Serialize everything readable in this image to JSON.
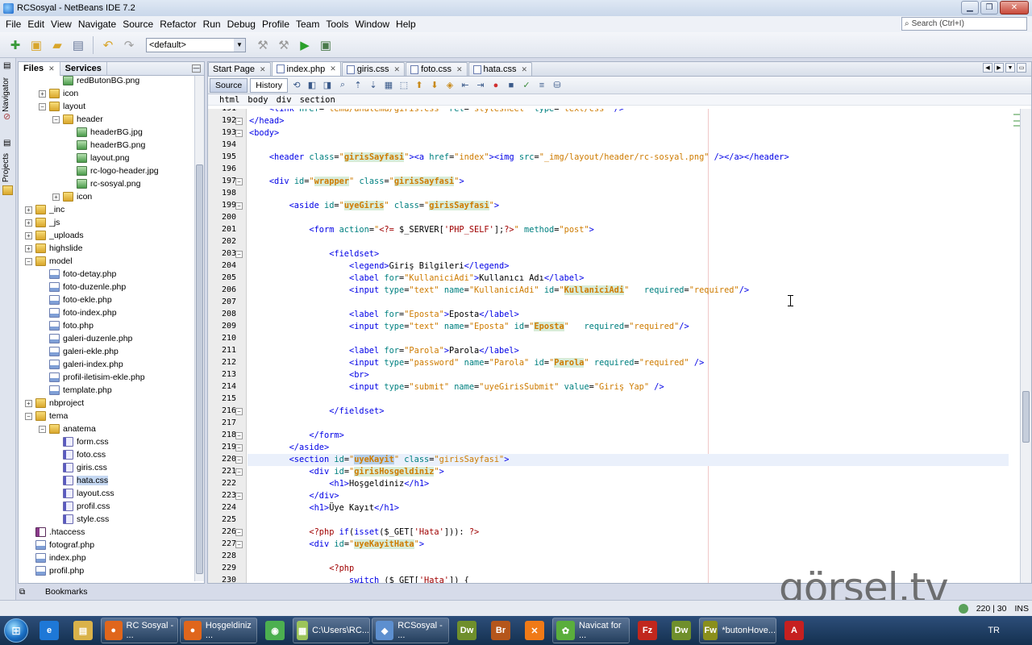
{
  "window": {
    "title": "RCSosyal - NetBeans IDE 7.2"
  },
  "menu": [
    "File",
    "Edit",
    "View",
    "Navigate",
    "Source",
    "Refactor",
    "Run",
    "Debug",
    "Profile",
    "Team",
    "Tools",
    "Window",
    "Help"
  ],
  "search": {
    "placeholder": "Search (Ctrl+I)"
  },
  "toolbar": {
    "config_value": "<default>"
  },
  "side_tabs": {
    "navigator": "Navigator",
    "projects": "Projects"
  },
  "files_panel": {
    "tabs": [
      "Files",
      "Services"
    ],
    "tree": [
      {
        "label": "redButonBG.png",
        "depth": 3,
        "type": "img",
        "exp": ""
      },
      {
        "label": "icon",
        "depth": 2,
        "type": "folder",
        "exp": "+"
      },
      {
        "label": "layout",
        "depth": 2,
        "type": "folder",
        "exp": "-"
      },
      {
        "label": "header",
        "depth": 3,
        "type": "folder",
        "exp": "-"
      },
      {
        "label": "headerBG.jpg",
        "depth": 4,
        "type": "img",
        "exp": ""
      },
      {
        "label": "headerBG.png",
        "depth": 4,
        "type": "img",
        "exp": ""
      },
      {
        "label": "layout.png",
        "depth": 4,
        "type": "img",
        "exp": ""
      },
      {
        "label": "rc-logo-header.jpg",
        "depth": 4,
        "type": "img",
        "exp": ""
      },
      {
        "label": "rc-sosyal.png",
        "depth": 4,
        "type": "img",
        "exp": ""
      },
      {
        "label": "icon",
        "depth": 3,
        "type": "folder",
        "exp": "+"
      },
      {
        "label": "_inc",
        "depth": 1,
        "type": "folder",
        "exp": "+"
      },
      {
        "label": "_js",
        "depth": 1,
        "type": "folder",
        "exp": "+"
      },
      {
        "label": "_uploads",
        "depth": 1,
        "type": "folder",
        "exp": "+"
      },
      {
        "label": "highslide",
        "depth": 1,
        "type": "folder",
        "exp": "+"
      },
      {
        "label": "model",
        "depth": 1,
        "type": "folder",
        "exp": "-"
      },
      {
        "label": "foto-detay.php",
        "depth": 2,
        "type": "php",
        "exp": ""
      },
      {
        "label": "foto-duzenle.php",
        "depth": 2,
        "type": "php",
        "exp": ""
      },
      {
        "label": "foto-ekle.php",
        "depth": 2,
        "type": "php",
        "exp": ""
      },
      {
        "label": "foto-index.php",
        "depth": 2,
        "type": "php",
        "exp": ""
      },
      {
        "label": "foto.php",
        "depth": 2,
        "type": "php",
        "exp": ""
      },
      {
        "label": "galeri-duzenle.php",
        "depth": 2,
        "type": "php",
        "exp": ""
      },
      {
        "label": "galeri-ekle.php",
        "depth": 2,
        "type": "php",
        "exp": ""
      },
      {
        "label": "galeri-index.php",
        "depth": 2,
        "type": "php",
        "exp": ""
      },
      {
        "label": "profil-iletisim-ekle.php",
        "depth": 2,
        "type": "php",
        "exp": ""
      },
      {
        "label": "template.php",
        "depth": 2,
        "type": "php",
        "exp": ""
      },
      {
        "label": "nbproject",
        "depth": 1,
        "type": "folder",
        "exp": "+"
      },
      {
        "label": "tema",
        "depth": 1,
        "type": "folder",
        "exp": "-"
      },
      {
        "label": "anatema",
        "depth": 2,
        "type": "folder",
        "exp": "-"
      },
      {
        "label": "form.css",
        "depth": 3,
        "type": "css",
        "exp": ""
      },
      {
        "label": "foto.css",
        "depth": 3,
        "type": "css",
        "exp": ""
      },
      {
        "label": "giris.css",
        "depth": 3,
        "type": "css",
        "exp": ""
      },
      {
        "label": "hata.css",
        "depth": 3,
        "type": "css",
        "exp": "",
        "selected": true
      },
      {
        "label": "layout.css",
        "depth": 3,
        "type": "css",
        "exp": ""
      },
      {
        "label": "profil.css",
        "depth": 3,
        "type": "css",
        "exp": ""
      },
      {
        "label": "style.css",
        "depth": 3,
        "type": "css",
        "exp": ""
      },
      {
        "label": ".htaccess",
        "depth": 1,
        "type": "hta",
        "exp": ""
      },
      {
        "label": "fotograf.php",
        "depth": 1,
        "type": "php",
        "exp": ""
      },
      {
        "label": "index.php",
        "depth": 1,
        "type": "php",
        "exp": ""
      },
      {
        "label": "profil.php",
        "depth": 1,
        "type": "php",
        "exp": ""
      }
    ],
    "bookmarks": "Bookmarks"
  },
  "editor": {
    "tabs": [
      {
        "label": "Start Page",
        "active": false
      },
      {
        "label": "index.php",
        "active": true
      },
      {
        "label": "giris.css",
        "active": false
      },
      {
        "label": "foto.css",
        "active": false
      },
      {
        "label": "hata.css",
        "active": false
      }
    ],
    "source_label": "Source",
    "history_label": "History",
    "breadcrumb": [
      "html",
      "body",
      "div",
      "section"
    ],
    "current_line": 220,
    "lines": [
      {
        "n": 191,
        "fold": "",
        "html": "    <span class=\"t\">&lt;link</span> <span class=\"a\">href</span>=<span class=\"v\">\"tema/anatema/giris.css\"</span> <span class=\"a\">rel</span>=<span class=\"v\">\"stylesheet\"</span> <span class=\"a\">type</span>=<span class=\"v\">\"text/css\"</span> <span class=\"t\">/&gt;</span>"
      },
      {
        "n": 192,
        "fold": "-",
        "html": "<span class=\"t\">&lt;/head&gt;</span>"
      },
      {
        "n": 193,
        "fold": "-",
        "html": "<span class=\"t\">&lt;body&gt;</span>"
      },
      {
        "n": 194,
        "fold": "",
        "html": ""
      },
      {
        "n": 195,
        "fold": "",
        "html": "    <span class=\"t\">&lt;header</span> <span class=\"a\">class</span>=<span class=\"v\">\"<span class=\"hl\">girisSayfasi</span>\"</span><span class=\"t\">&gt;&lt;a</span> <span class=\"a\">href</span>=<span class=\"v\">\"index\"</span><span class=\"t\">&gt;&lt;img</span> <span class=\"a\">src</span>=<span class=\"v\">\"_img/layout/header/rc-sosyal.png\"</span> <span class=\"t\">/&gt;&lt;/a&gt;&lt;/header&gt;</span>"
      },
      {
        "n": 196,
        "fold": "",
        "html": ""
      },
      {
        "n": 197,
        "fold": "-",
        "html": "    <span class=\"t\">&lt;div</span> <span class=\"a\">id</span>=<span class=\"v\">\"<span class=\"hl\">wrapper</span>\"</span> <span class=\"a\">class</span>=<span class=\"v\">\"<span class=\"hl\">girisSayfasi</span>\"</span><span class=\"t\">&gt;</span>"
      },
      {
        "n": 198,
        "fold": "",
        "html": ""
      },
      {
        "n": 199,
        "fold": "-",
        "html": "        <span class=\"t\">&lt;aside</span> <span class=\"a\">id</span>=<span class=\"v\">\"<span class=\"hl\">uyeGiris</span>\"</span> <span class=\"a\">class</span>=<span class=\"v\">\"<span class=\"hl\">girisSayfasi</span>\"</span><span class=\"t\">&gt;</span>"
      },
      {
        "n": 200,
        "fold": "",
        "html": ""
      },
      {
        "n": 201,
        "fold": "",
        "html": "            <span class=\"t\">&lt;form</span> <span class=\"a\">action</span>=<span class=\"v\">\"</span><span class=\"phpk\">&lt;?=</span> $_SERVER[<span class=\"phpk\">'PHP_SELF'</span>];<span class=\"phpk\">?&gt;</span><span class=\"v\">\"</span> <span class=\"a\">method</span>=<span class=\"v\">\"post\"</span><span class=\"t\">&gt;</span>"
      },
      {
        "n": 202,
        "fold": "",
        "html": ""
      },
      {
        "n": 203,
        "fold": "-",
        "html": "                <span class=\"t\">&lt;fieldset&gt;</span>"
      },
      {
        "n": 204,
        "fold": "",
        "html": "                    <span class=\"t\">&lt;legend&gt;</span>Giriş Bilgileri<span class=\"t\">&lt;/legend&gt;</span>"
      },
      {
        "n": 205,
        "fold": "",
        "html": "                    <span class=\"t\">&lt;label</span> <span class=\"a\">for</span>=<span class=\"v\">\"KullaniciAdi\"</span><span class=\"t\">&gt;</span>Kullanıcı Adı<span class=\"t\">&lt;/label&gt;</span>"
      },
      {
        "n": 206,
        "fold": "",
        "html": "                    <span class=\"t\">&lt;input</span> <span class=\"a\">type</span>=<span class=\"v\">\"text\"</span> <span class=\"a\">name</span>=<span class=\"v\">\"KullaniciAdi\"</span> <span class=\"a\">id</span>=<span class=\"v\">\"<span class=\"hl\">KullaniciAdi</span>\"</span>   <span class=\"a\">required</span>=<span class=\"v\">\"required\"</span><span class=\"t\">/&gt;</span>"
      },
      {
        "n": 207,
        "fold": "",
        "html": ""
      },
      {
        "n": 208,
        "fold": "",
        "html": "                    <span class=\"t\">&lt;label</span> <span class=\"a\">for</span>=<span class=\"v\">\"Eposta\"</span><span class=\"t\">&gt;</span>Eposta<span class=\"t\">&lt;/label&gt;</span>"
      },
      {
        "n": 209,
        "fold": "",
        "html": "                    <span class=\"t\">&lt;input</span> <span class=\"a\">type</span>=<span class=\"v\">\"text\"</span> <span class=\"a\">name</span>=<span class=\"v\">\"Eposta\"</span> <span class=\"a\">id</span>=<span class=\"v\">\"<span class=\"hl\">Eposta</span>\"</span>   <span class=\"a\">required</span>=<span class=\"v\">\"required\"</span><span class=\"t\">/&gt;</span>"
      },
      {
        "n": 210,
        "fold": "",
        "html": ""
      },
      {
        "n": 211,
        "fold": "",
        "html": "                    <span class=\"t\">&lt;label</span> <span class=\"a\">for</span>=<span class=\"v\">\"Parola\"</span><span class=\"t\">&gt;</span>Parola<span class=\"t\">&lt;/label&gt;</span>"
      },
      {
        "n": 212,
        "fold": "",
        "html": "                    <span class=\"t\">&lt;input</span> <span class=\"a\">type</span>=<span class=\"v\">\"password\"</span> <span class=\"a\">name</span>=<span class=\"v\">\"Parola\"</span> <span class=\"a\">id</span>=<span class=\"v\">\"<span class=\"hl\">Parola</span>\"</span> <span class=\"a\">required</span>=<span class=\"v\">\"required\"</span> <span class=\"t\">/&gt;</span>"
      },
      {
        "n": 213,
        "fold": "",
        "html": "                    <span class=\"t\">&lt;br&gt;</span>"
      },
      {
        "n": 214,
        "fold": "",
        "html": "                    <span class=\"t\">&lt;input</span> <span class=\"a\">type</span>=<span class=\"v\">\"submit\"</span> <span class=\"a\">name</span>=<span class=\"v\">\"uyeGirisSubmit\"</span> <span class=\"a\">value</span>=<span class=\"v\">\"Giriş Yap\"</span> <span class=\"t\">/&gt;</span>"
      },
      {
        "n": 215,
        "fold": "",
        "html": ""
      },
      {
        "n": 216,
        "fold": "-",
        "html": "                <span class=\"t\">&lt;/fieldset&gt;</span>"
      },
      {
        "n": 217,
        "fold": "",
        "html": ""
      },
      {
        "n": 218,
        "fold": "-",
        "html": "            <span class=\"t\">&lt;/form&gt;</span>"
      },
      {
        "n": 219,
        "fold": "-",
        "html": "        <span class=\"t\">&lt;/aside&gt;</span>"
      },
      {
        "n": 220,
        "fold": "-",
        "html": "        <span class=\"t\">&lt;section</span> <span class=\"a\">id</span>=<span class=\"v\">\"<span class=\"hl\" style=\"background:#b6cee8\">uyeKayit</span>\"</span> <span class=\"a\">class</span>=<span class=\"v\">\"girisSayfasi\"</span><span class=\"t\">&gt;</span>"
      },
      {
        "n": 221,
        "fold": "-",
        "html": "            <span class=\"t\">&lt;div</span> <span class=\"a\">id</span>=<span class=\"v\">\"<span class=\"hl\">girisHosgeldiniz</span>\"</span><span class=\"t\">&gt;</span>"
      },
      {
        "n": 222,
        "fold": "",
        "html": "                <span class=\"t\">&lt;h1&gt;</span>Hoşgeldiniz<span class=\"t\">&lt;/h1&gt;</span>"
      },
      {
        "n": 223,
        "fold": "-",
        "html": "            <span class=\"t\">&lt;/div&gt;</span>"
      },
      {
        "n": 224,
        "fold": "",
        "html": "            <span class=\"t\">&lt;h1&gt;</span>Üye Kayıt<span class=\"t\">&lt;/h1&gt;</span>"
      },
      {
        "n": 225,
        "fold": "",
        "html": ""
      },
      {
        "n": 226,
        "fold": "-",
        "html": "            <span class=\"phpk\">&lt;?php</span> <span class=\"t\">if</span>(<span class=\"t\">isset</span>($_GET[<span class=\"phpk\">'Hata'</span>])): <span class=\"phpk\">?&gt;</span>"
      },
      {
        "n": 227,
        "fold": "-",
        "html": "            <span class=\"t\">&lt;div</span> <span class=\"a\">id</span>=<span class=\"v\">\"<span class=\"hl\">uyeKayitHata</span>\"</span><span class=\"t\">&gt;</span>"
      },
      {
        "n": 228,
        "fold": "",
        "html": ""
      },
      {
        "n": 229,
        "fold": "",
        "html": "                <span class=\"phpk\">&lt;?php</span>"
      },
      {
        "n": 230,
        "fold": "",
        "html": "                    <span class=\"t\">switch</span> ($_GET[<span class=\"phpk\">'Hata'</span>]) {"
      }
    ]
  },
  "status": {
    "position": "220 | 30",
    "mode": "INS"
  },
  "watermark": "görsel.tv",
  "taskbar": {
    "start": "Start",
    "items": [
      {
        "label": "",
        "icon": "internet-explorer-icon",
        "color": "#1e78d7",
        "glyph": "e"
      },
      {
        "label": "",
        "icon": "explorer-folder-icon",
        "color": "#d9b24a",
        "glyph": "▤"
      },
      {
        "label": "RC Sosyal - ...",
        "icon": "firefox-icon",
        "color": "#e0661c",
        "glyph": "●"
      },
      {
        "label": "Hoşgeldiniz ...",
        "icon": "firefox-icon",
        "color": "#e0661c",
        "glyph": "●"
      },
      {
        "label": "",
        "icon": "chrome-icon",
        "color": "#4caf50",
        "glyph": "◉"
      },
      {
        "label": "C:\\Users\\RC...",
        "icon": "notepad-icon",
        "color": "#9cc45a",
        "glyph": "▦"
      },
      {
        "label": "RCSosyal - ...",
        "icon": "netbeans-icon",
        "color": "#5d8fcf",
        "glyph": "◆"
      },
      {
        "label": "",
        "icon": "dreamweaver-icon",
        "color": "#6f8f2c",
        "glyph": "Dw"
      },
      {
        "label": "",
        "icon": "bridge-icon",
        "color": "#b5561b",
        "glyph": "Br"
      },
      {
        "label": "",
        "icon": "xampp-icon",
        "color": "#f07a17",
        "glyph": "✕"
      },
      {
        "label": "Navicat for ...",
        "icon": "navicat-icon",
        "color": "#5aae3c",
        "glyph": "✿"
      },
      {
        "label": "",
        "icon": "filezilla-icon",
        "color": "#c1271d",
        "glyph": "Fz"
      },
      {
        "label": "",
        "icon": "dreamweaver-icon",
        "color": "#6f8f2c",
        "glyph": "Dw"
      },
      {
        "label": "*butonHove...",
        "icon": "fireworks-icon",
        "color": "#8a8f1c",
        "glyph": "Fw"
      },
      {
        "label": "",
        "icon": "acrobat-icon",
        "color": "#c62020",
        "glyph": "A"
      }
    ],
    "lang": "TR"
  }
}
